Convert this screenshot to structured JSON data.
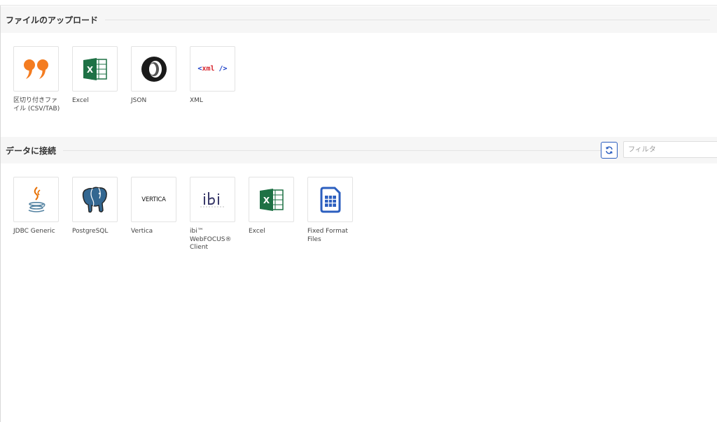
{
  "upload_section": {
    "title": "ファイルのアップロード",
    "tiles": [
      {
        "label": "区切り付きファイル (CSV/TAB)",
        "icon": "quote-icon"
      },
      {
        "label": "Excel",
        "icon": "excel-icon"
      },
      {
        "label": "JSON",
        "icon": "json-icon"
      },
      {
        "label": "XML",
        "icon": "xml-icon"
      }
    ]
  },
  "connect_section": {
    "title": "データに接続",
    "filter_placeholder": "フィルタ",
    "tiles": [
      {
        "label": "JDBC Generic",
        "icon": "java-icon"
      },
      {
        "label": "PostgreSQL",
        "icon": "postgresql-elephant-icon"
      },
      {
        "label": "Vertica",
        "icon": "vertica-logo-icon",
        "logo_text": "VERTICA"
      },
      {
        "label": "ibi™ WebFOCUS® Client",
        "icon": "ibi-logo-icon",
        "logo_text": "ibi"
      },
      {
        "label": "Excel",
        "icon": "excel-icon"
      },
      {
        "label": "Fixed Format Files",
        "icon": "fixed-format-file-icon"
      }
    ]
  },
  "colors": {
    "quote_orange": "#f47c20",
    "excel_green": "#1e7145",
    "xml_blue": "#1a3fc7",
    "xml_red": "#d7262e",
    "accent_blue": "#2c5fbf",
    "postgres_blue": "#336791"
  }
}
